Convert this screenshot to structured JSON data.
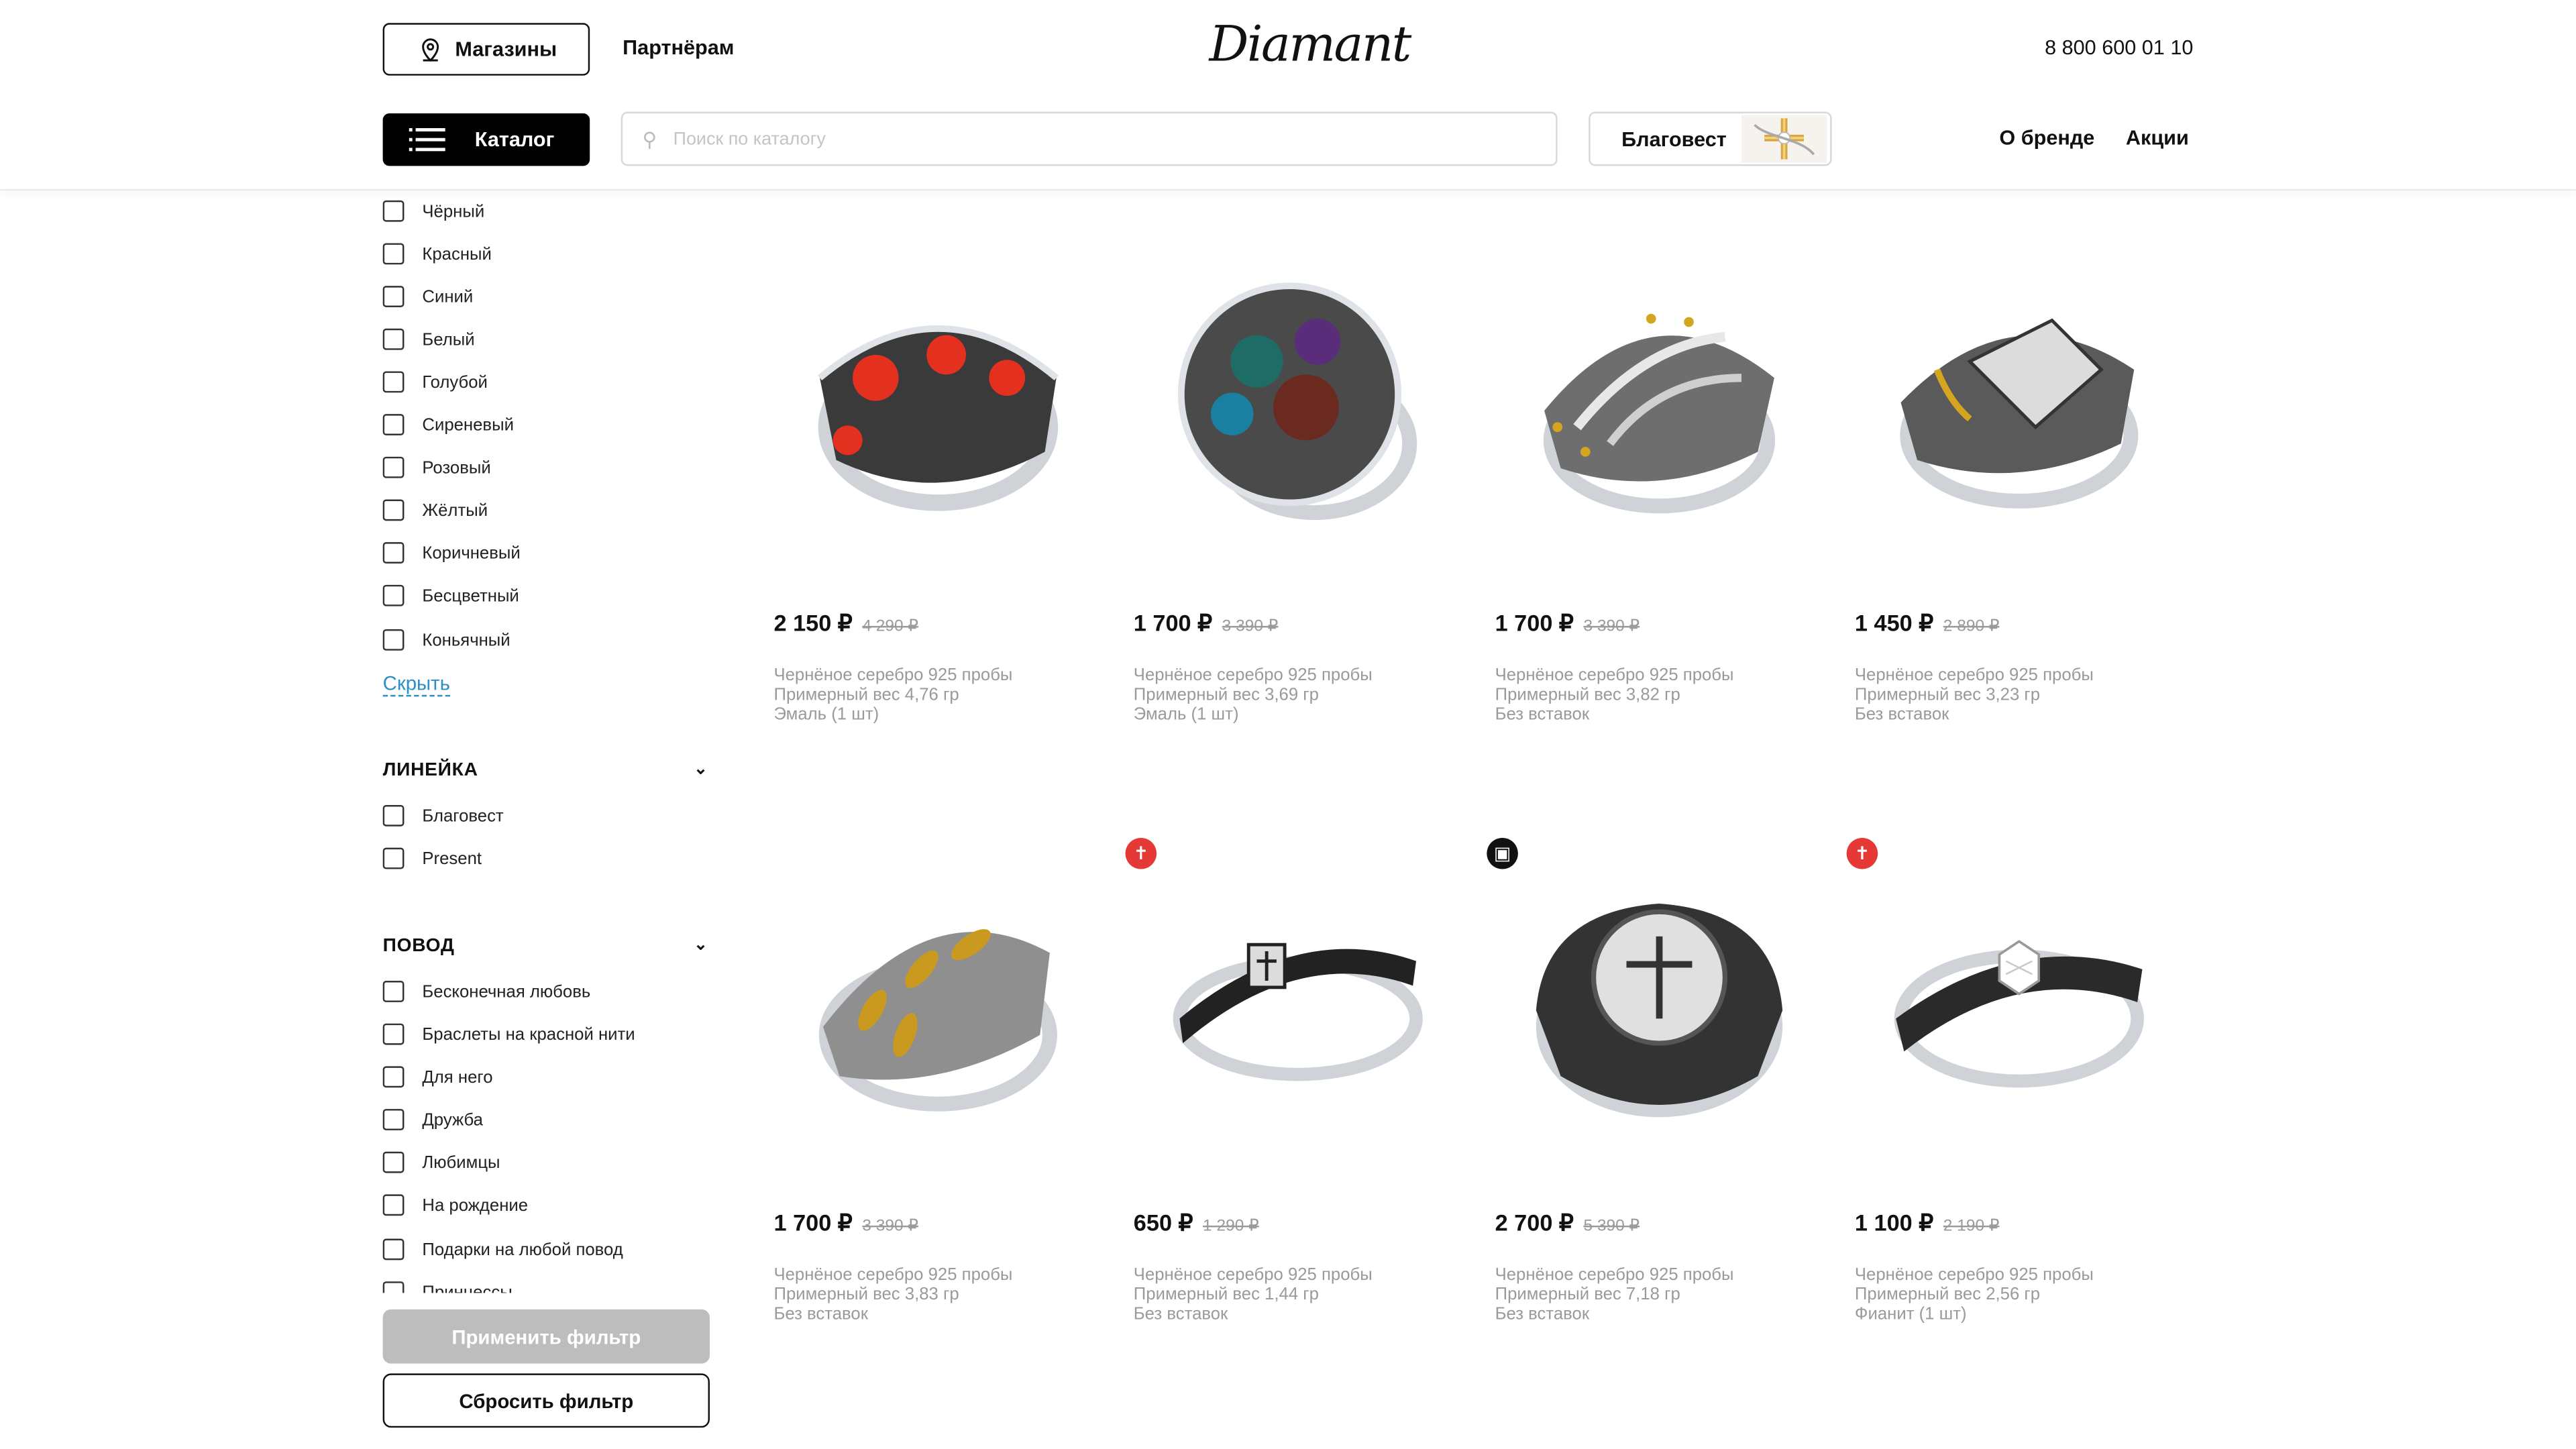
{
  "header": {
    "stores_label": "Магазины",
    "partners_label": "Партнёрам",
    "logo_text": "Diamant",
    "phone": "8 800 600 01 10",
    "catalog_label": "Каталог",
    "search_placeholder": "Поиск по каталогу",
    "blagovest_label": "Благовест",
    "nav": [
      "О бренде",
      "Акции"
    ]
  },
  "filters": {
    "colors": [
      "Чёрный",
      "Красный",
      "Синий",
      "Белый",
      "Голубой",
      "Сиреневый",
      "Розовый",
      "Жёлтый",
      "Коричневый",
      "Бесцветный",
      "Коньячный"
    ],
    "hide_label": "Скрыть",
    "line_title": "ЛИНЕЙКА",
    "line_items": [
      "Благовест",
      "Present"
    ],
    "occasion_title": "ПОВОД",
    "occasion_items": [
      "Бесконечная любовь",
      "Браслеты на красной нити",
      "Для него",
      "Дружба",
      "Любимцы",
      "На рождение",
      "Подарки на любой повод",
      "Принцессы"
    ],
    "apply_label": "Применить фильтр",
    "reset_label": "Сбросить фильтр"
  },
  "products": [
    {
      "price": "2 150 ₽",
      "old_price": "4 290 ₽",
      "material": "Чернёное серебро 925 пробы",
      "weight": "Примерный вес 4,76 гр",
      "insert": "Эмаль (1 шт)",
      "badge": ""
    },
    {
      "price": "1 700 ₽",
      "old_price": "3 390 ₽",
      "material": "Чернёное серебро 925 пробы",
      "weight": "Примерный вес 3,69 гр",
      "insert": "Эмаль (1 шт)",
      "badge": ""
    },
    {
      "price": "1 700 ₽",
      "old_price": "3 390 ₽",
      "material": "Чернёное серебро 925 пробы",
      "weight": "Примерный вес 3,82 гр",
      "insert": "Без вставок",
      "badge": ""
    },
    {
      "price": "1 450 ₽",
      "old_price": "2 890 ₽",
      "material": "Чернёное серебро 925 пробы",
      "weight": "Примерный вес 3,23 гр",
      "insert": "Без вставок",
      "badge": ""
    },
    {
      "price": "1 700 ₽",
      "old_price": "3 390 ₽",
      "material": "Чернёное серебро 925 пробы",
      "weight": "Примерный вес 3,83 гр",
      "insert": "Без вставок",
      "badge": ""
    },
    {
      "price": "650 ₽",
      "old_price": "1 290 ₽",
      "material": "Чернёное серебро 925 пробы",
      "weight": "Примерный вес 1,44 гр",
      "insert": "Без вставок",
      "badge": "cross-icon"
    },
    {
      "price": "2 700 ₽",
      "old_price": "5 390 ₽",
      "material": "Чернёное серебро 925 пробы",
      "weight": "Примерный вес 7,18 гр",
      "insert": "Без вставок",
      "badge": "gift-icon"
    },
    {
      "price": "1 100 ₽",
      "old_price": "2 190 ₽",
      "material": "Чернёное серебро 925 пробы",
      "weight": "Примерный вес 2,56 гр",
      "insert": "Фианит (1 шт)",
      "badge": "cross-icon"
    }
  ],
  "colors": {
    "accent_link": "#2c8fc7",
    "badge_red": "#e53935",
    "badge_black": "#111111",
    "apply_disabled": "#bdbdbd"
  }
}
